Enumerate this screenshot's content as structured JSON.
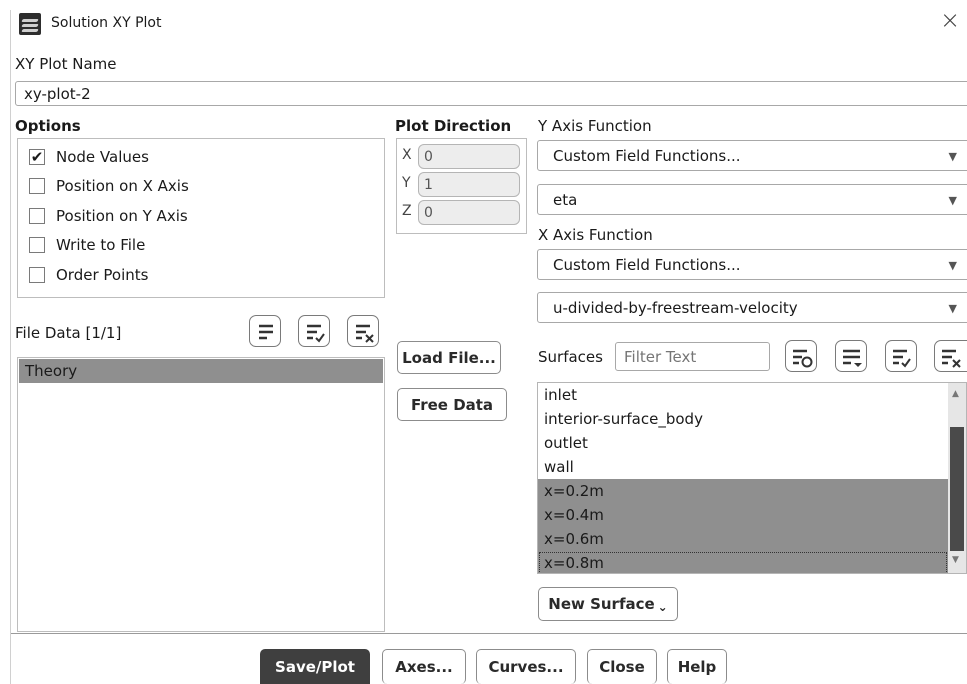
{
  "window": {
    "title": "Solution XY Plot",
    "close_glyph": "×"
  },
  "plot_name": {
    "label": "XY Plot Name",
    "value": "xy-plot-2"
  },
  "options": {
    "heading": "Options",
    "items": [
      {
        "label": "Node Values",
        "checked": true
      },
      {
        "label": "Position on X Axis",
        "checked": false
      },
      {
        "label": "Position on Y Axis",
        "checked": false
      },
      {
        "label": "Write to File",
        "checked": false
      },
      {
        "label": "Order Points",
        "checked": false
      }
    ]
  },
  "plot_direction": {
    "heading": "Plot Direction",
    "x_label": "X",
    "x_value": "0",
    "y_label": "Y",
    "y_value": "1",
    "z_label": "Z",
    "z_value": "0"
  },
  "y_axis": {
    "label": "Y Axis Function",
    "category": "Custom Field Functions...",
    "function": "eta"
  },
  "x_axis": {
    "label": "X Axis Function",
    "category": "Custom Field Functions...",
    "function": "u-divided-by-freestream-velocity"
  },
  "file_data": {
    "label": "File Data",
    "count": "[1/1]",
    "items": [
      "Theory"
    ]
  },
  "file_buttons": {
    "load": "Load File...",
    "free": "Free Data"
  },
  "surfaces": {
    "label": "Surfaces",
    "filter_placeholder": "Filter Text",
    "items": [
      {
        "name": "inlet",
        "selected": false
      },
      {
        "name": "interior-surface_body",
        "selected": false
      },
      {
        "name": "outlet",
        "selected": false
      },
      {
        "name": "wall",
        "selected": false
      },
      {
        "name": "x=0.2m",
        "selected": true
      },
      {
        "name": "x=0.4m",
        "selected": true
      },
      {
        "name": "x=0.6m",
        "selected": true
      },
      {
        "name": "x=0.8m",
        "selected": true
      }
    ],
    "new_surface": "New Surface",
    "dropdown_glyph": "⌄"
  },
  "footer": {
    "save_plot": "Save/Plot",
    "axes": "Axes...",
    "curves": "Curves...",
    "close": "Close",
    "help": "Help"
  },
  "icons": {
    "app": "ansys-fluent-icon",
    "select_all": "select-all-icon",
    "deselect_all": "deselect-all-icon",
    "filter_groups": "filter-options-icon",
    "arrow": "dropdown-arrow-icon"
  },
  "colors": {
    "selected_row": "#8f8f8f",
    "primary_button": "#3f3f3f",
    "scrollbar_thumb": "#4a4a4a"
  }
}
